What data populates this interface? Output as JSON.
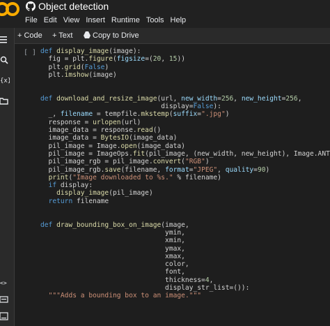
{
  "title": "Object detection",
  "menu": [
    "File",
    "Edit",
    "View",
    "Insert",
    "Runtime",
    "Tools",
    "Help"
  ],
  "toolbar": {
    "code_label": "+ Code",
    "text_label": "+ Text",
    "drive_label": "Copy to Drive"
  },
  "cell": {
    "brackets": "[ ]",
    "lines": [
      "def display_image(image):",
      "  fig = plt.figure(figsize=(20, 15))",
      "  plt.grid(False)",
      "  plt.imshow(image)",
      "",
      "",
      "def download_and_resize_image(url, new_width=256, new_height=256,",
      "                              display=False):",
      "  _, filename = tempfile.mkstemp(suffix=\".jpg\")",
      "  response = urlopen(url)",
      "  image_data = response.read()",
      "  image_data = BytesIO(image_data)",
      "  pil_image = Image.open(image_data)",
      "  pil_image = ImageOps.fit(pil_image, (new_width, new_height), Image.ANTIALIAS)",
      "  pil_image_rgb = pil_image.convert(\"RGB\")",
      "  pil_image_rgb.save(filename, format=\"JPEG\", quality=90)",
      "  print(\"Image downloaded to %s.\" % filename)",
      "  if display:",
      "    display_image(pil_image)",
      "  return filename",
      "",
      "",
      "def draw_bounding_box_on_image(image,",
      "                               ymin,",
      "                               xmin,",
      "                               ymax,",
      "                               xmax,",
      "                               color,",
      "                               font,",
      "                               thickness=4,",
      "                               display_str_list=()):",
      "  \"\"\"Adds a bounding box to an image.\"\"\""
    ]
  },
  "colors": {
    "background": "#1e1e1e",
    "keyword": "#569cd6",
    "function": "#dcdcaa",
    "string": "#ce9178",
    "number": "#b5cea8"
  },
  "icons": [
    "colab-logo",
    "github-icon",
    "menu-icon",
    "search-icon",
    "variables-icon",
    "folder-icon",
    "code-snippets-icon",
    "terminal-icon",
    "drive-icon"
  ]
}
